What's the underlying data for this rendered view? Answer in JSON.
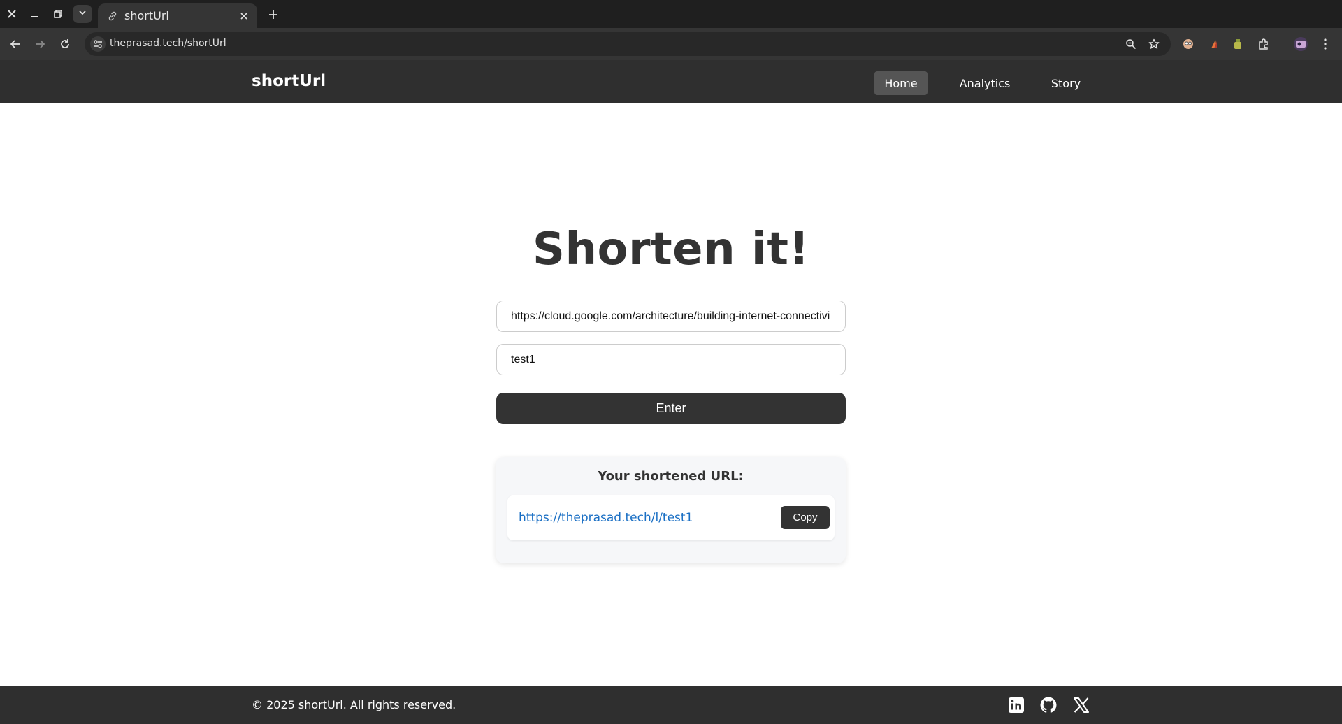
{
  "browser": {
    "tab_title": "shortUrl",
    "address": "theprasad.tech/shortUrl"
  },
  "header": {
    "brand": "shortUrl",
    "nav": [
      {
        "label": "Home",
        "active": true
      },
      {
        "label": "Analytics",
        "active": false
      },
      {
        "label": "Story",
        "active": false
      }
    ]
  },
  "main": {
    "headline": "Shorten it!",
    "long_url_value": "https://cloud.google.com/architecture/building-internet-connectivi",
    "alias_value": "test1",
    "enter_label": "Enter"
  },
  "result": {
    "title": "Your shortened URL:",
    "short_url": "https://theprasad.tech/l/test1",
    "copy_label": "Copy"
  },
  "footer": {
    "copyright": "© 2025 shortUrl. All rights reserved.",
    "social_icons": [
      "linkedin-icon",
      "github-icon",
      "x-icon"
    ]
  },
  "colors": {
    "header_bg": "#2f2f2f",
    "button_bg": "#333333",
    "link": "#1a6fc4",
    "nav_active_bg": "#555555"
  }
}
